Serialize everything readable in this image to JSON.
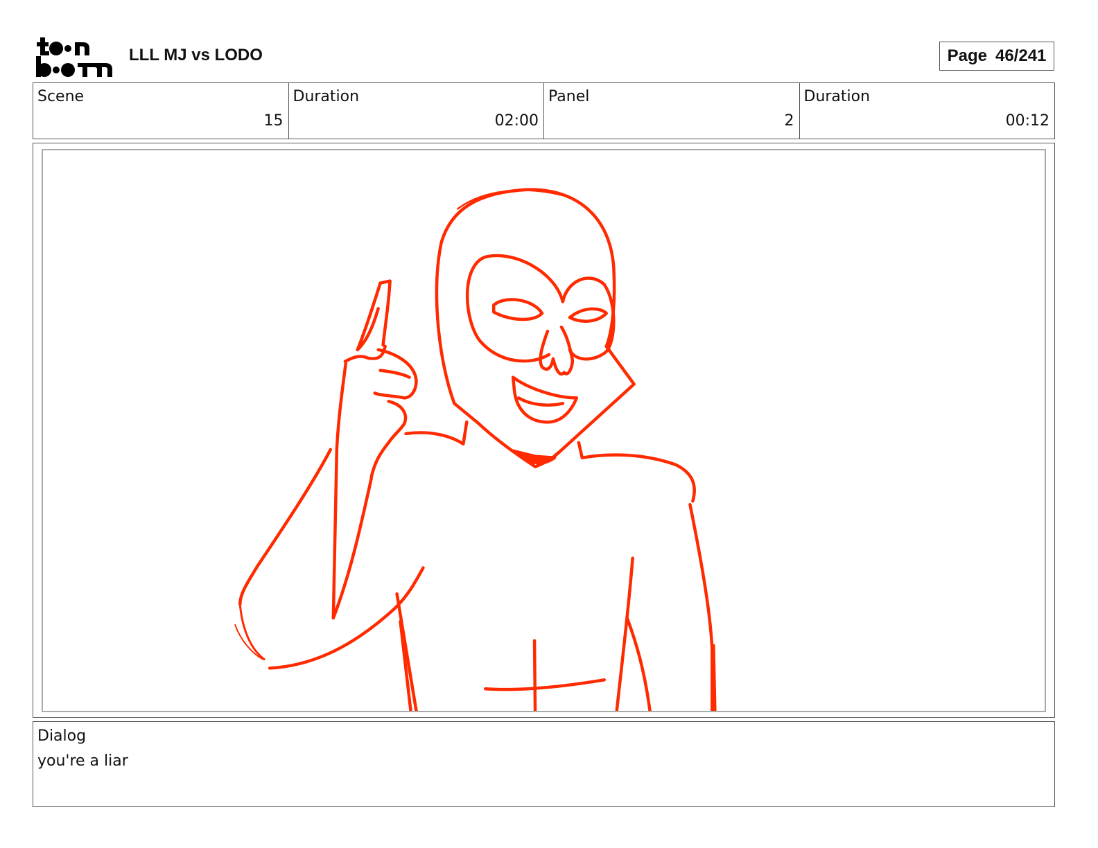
{
  "header": {
    "logo": {
      "line1": "toon",
      "line2": "boom"
    },
    "title": "LLL MJ vs LODO",
    "page_label": "Page",
    "page_number": "46/241"
  },
  "info": [
    {
      "label": "Scene",
      "value": "15"
    },
    {
      "label": "Duration",
      "value": "02:00"
    },
    {
      "label": "Panel",
      "value": "2"
    },
    {
      "label": "Duration",
      "value": "00:12"
    }
  ],
  "panel": {
    "sketch_color": "#ff2a00"
  },
  "dialog": {
    "label": "Dialog",
    "text": "you're a liar"
  }
}
